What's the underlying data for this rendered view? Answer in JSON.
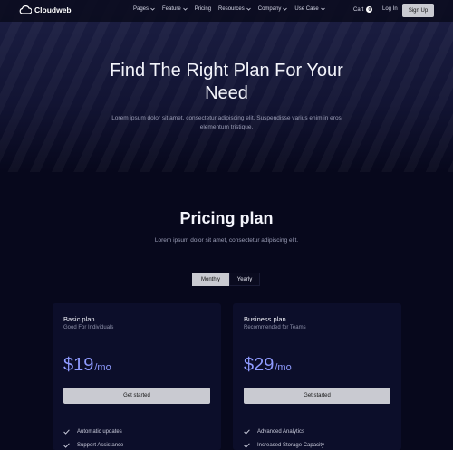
{
  "brand": {
    "name": "Cloudweb"
  },
  "nav": {
    "items": [
      {
        "label": "Pages",
        "dropdown": true
      },
      {
        "label": "Feature",
        "dropdown": true
      },
      {
        "label": "Pricing",
        "dropdown": false
      },
      {
        "label": "Resources",
        "dropdown": true
      },
      {
        "label": "Company",
        "dropdown": true
      },
      {
        "label": "Use Case",
        "dropdown": true
      }
    ],
    "cart_label": "Cart",
    "cart_count": "0",
    "login_label": "Log In",
    "signup_label": "Sign Up"
  },
  "hero": {
    "title": "Find The Right Plan For Your Need",
    "subtitle": "Lorem ipsum dolor sit amet, consectetur adipiscing elit. Suspendisse varius enim in eros elementum tristique."
  },
  "pricing": {
    "title": "Pricing plan",
    "subtitle": "Lorem ipsum dolor sit amet, consectetur adipiscing elit.",
    "billing_toggle": {
      "options": [
        "Monthly",
        "Yearly"
      ],
      "selected": "Monthly"
    },
    "plans": [
      {
        "name": "Basic plan",
        "tagline": "Good For Individuals",
        "price": "$19",
        "period": "/mo",
        "cta": "Get started",
        "features": [
          "Automatic updates",
          "Support Assistance"
        ]
      },
      {
        "name": "Business plan",
        "tagline": "Recommended for Teams",
        "price": "$29",
        "period": "/mo",
        "cta": "Get started",
        "features": [
          "Advanced Analytics",
          "Increased Storage Capacity"
        ]
      }
    ]
  },
  "colors": {
    "background": "#07081c",
    "card": "#0c0e2a",
    "accent_price": "#8f9bff",
    "button": "#c9cad1"
  },
  "icons": [
    "cloud-logo-icon",
    "chevron-down-icon",
    "check-icon"
  ]
}
